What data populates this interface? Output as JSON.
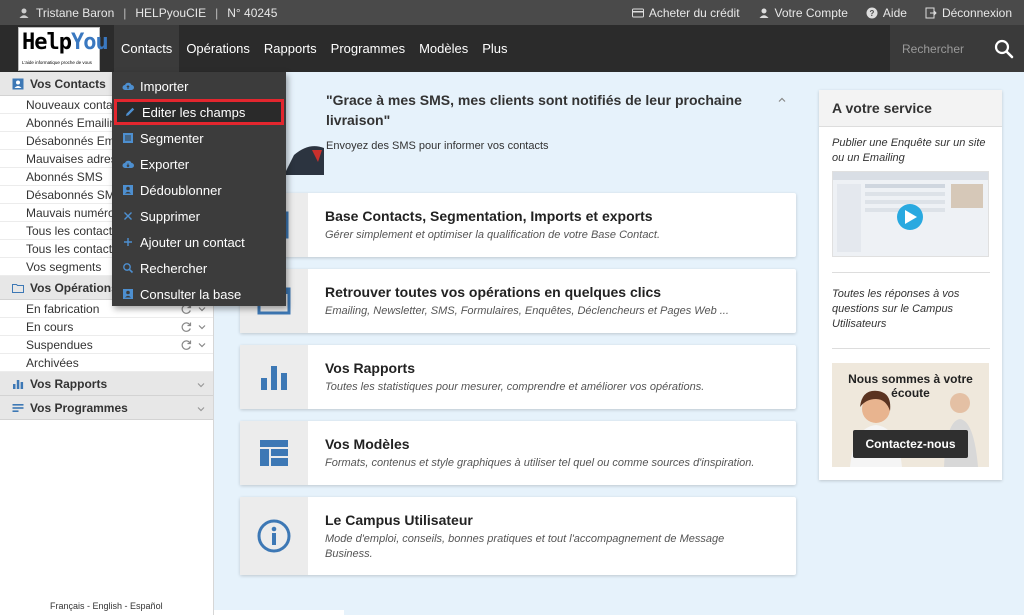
{
  "topbar": {
    "user_name": "Tristane Baron",
    "company": "HELPyouCIE",
    "account_number": "N° 40245",
    "links": {
      "buy_credit": "Acheter du crédit",
      "your_account": "Votre Compte",
      "help": "Aide",
      "logout": "Déconnexion"
    }
  },
  "logo": {
    "part1": "Help",
    "part2": "You",
    "tagline": "L'aide informatique proche de vous"
  },
  "nav": {
    "items": [
      "Contacts",
      "Opérations",
      "Rapports",
      "Programmes",
      "Modèles",
      "Plus"
    ],
    "search_placeholder": "Rechercher"
  },
  "dropdown": {
    "items": [
      {
        "label": "Importer",
        "icon": "cloud-upload-icon"
      },
      {
        "label": "Editer les champs",
        "icon": "pencil-icon"
      },
      {
        "label": "Segmenter",
        "icon": "list-icon"
      },
      {
        "label": "Exporter",
        "icon": "cloud-download-icon"
      },
      {
        "label": "Dédoublonner",
        "icon": "contact-card-icon"
      },
      {
        "label": "Supprimer",
        "icon": "x-icon"
      },
      {
        "label": "Ajouter un contact",
        "icon": "plus-icon"
      },
      {
        "label": "Rechercher",
        "icon": "search-icon"
      },
      {
        "label": "Consulter la base",
        "icon": "contact-card-icon"
      }
    ]
  },
  "sidebar": {
    "contacts_title": "Vos Contacts",
    "contacts_items": [
      "Nouveaux contacts",
      "Abonnés Emailing",
      "Désabonnés Emailing",
      "Mauvaises adresses",
      "Abonnés SMS",
      "Désabonnés SMS",
      "Mauvais numéros",
      "Tous les contacts",
      "Tous les contacts",
      "Vos segments"
    ],
    "operations_title": "Vos Opérations",
    "operations_items": [
      "En fabrication",
      "En cours",
      "Suspendues",
      "Archivées"
    ],
    "reports_title": "Vos Rapports",
    "programs_title": "Vos Programmes",
    "languages": [
      "Français",
      "English",
      "Español"
    ]
  },
  "hero": {
    "quote": "\"Grace à mes SMS, mes clients sont notifiés de leur prochaine livraison\"",
    "subtitle": "Envoyez des SMS pour informer vos contacts"
  },
  "cards": [
    {
      "title": "Base Contacts, Segmentation, Imports et exports",
      "desc": "Gérer simplement et optimiser la qualification de votre Base Contact."
    },
    {
      "title": "Retrouver toutes vos opérations en quelques clics",
      "desc": "Emailing, Newsletter, SMS, Formulaires, Enquêtes, Déclencheurs et Pages Web ..."
    },
    {
      "title": "Vos Rapports",
      "desc": "Toutes les statistiques pour mesurer, comprendre et améliorer vos opérations."
    },
    {
      "title": "Vos Modèles",
      "desc": "Formats, contenus et style graphiques à utiliser tel quel ou comme sources d'inspiration."
    },
    {
      "title": "Le Campus Utilisateur",
      "desc": "Mode d'emploi, conseils, bonnes pratiques et tout l'accompagnement de Message Business."
    }
  ],
  "panel": {
    "title": "A votre service",
    "text1": "Publier une Enquête sur un site ou un Emailing",
    "text2": "Toutes les réponses à vos questions sur le Campus Utilisateurs",
    "contact_title": "Nous sommes à votre écoute",
    "contact_button": "Contactez-nous"
  },
  "colors": {
    "accent": "#3a78c0",
    "highlight_border": "#e3262e",
    "icon_blue": "#3d78b5"
  }
}
